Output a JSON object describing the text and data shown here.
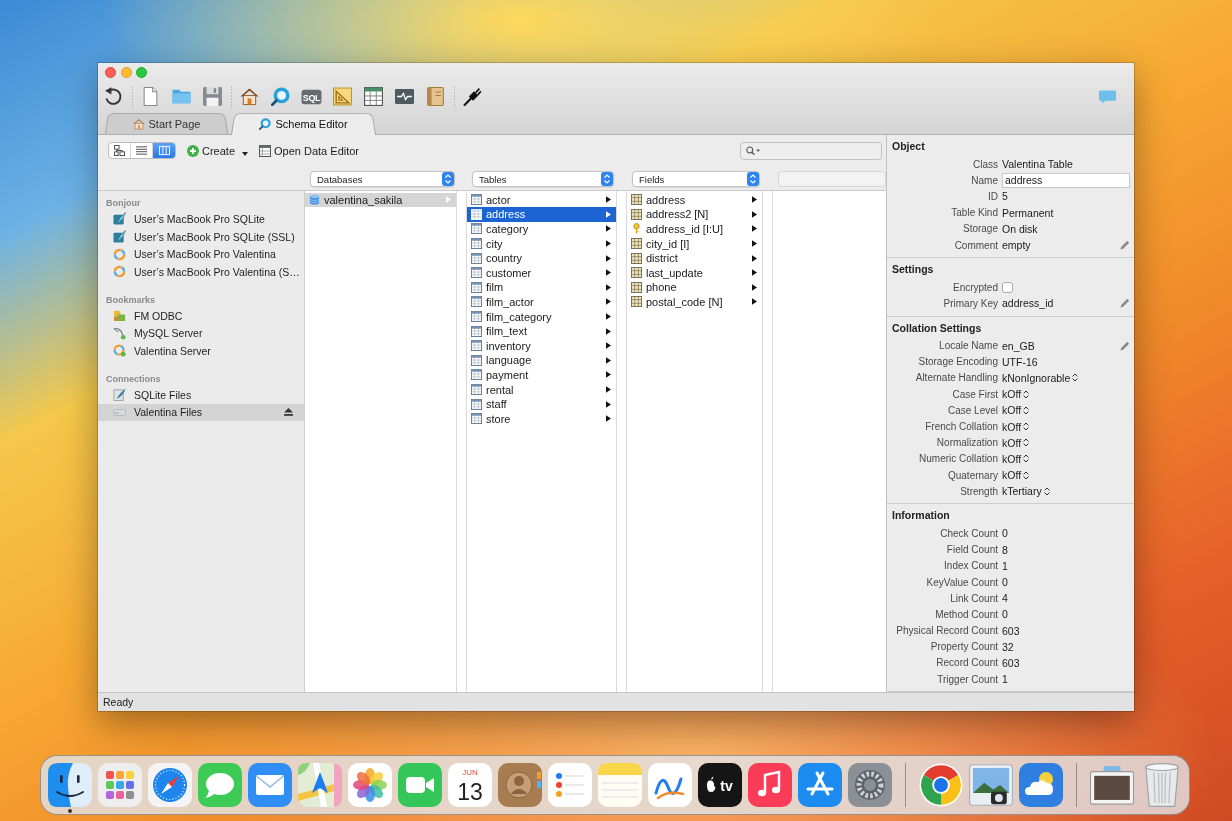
{
  "toolbar": {
    "groups": [
      {
        "items": [
          {
            "kind": "refresh"
          }
        ]
      },
      {
        "items": [
          {
            "kind": "new"
          },
          {
            "kind": "open"
          },
          {
            "kind": "save"
          }
        ]
      },
      {
        "items": [
          {
            "kind": "home"
          },
          {
            "kind": "schema"
          },
          {
            "kind": "sql",
            "label": "SQL"
          },
          {
            "kind": "triangle"
          },
          {
            "kind": "table"
          },
          {
            "kind": "monitor"
          },
          {
            "kind": "book"
          }
        ]
      },
      {
        "items": [
          {
            "kind": "plug"
          }
        ]
      }
    ]
  },
  "tabs": [
    {
      "label": "Start Page",
      "kind": "start",
      "selected": false
    },
    {
      "label": "Schema Editor",
      "kind": "schema",
      "selected": true
    }
  ],
  "view_modes": [
    {
      "kind": "diagram",
      "selected": false
    },
    {
      "kind": "list",
      "selected": false
    },
    {
      "kind": "columns",
      "selected": true
    }
  ],
  "actions": [
    {
      "label": "Create",
      "kind": "create",
      "menu": true
    },
    {
      "label": "Open Data Editor",
      "kind": "data_editor",
      "menu": false
    }
  ],
  "sidebar": {
    "sections": [
      {
        "title": "Bonjour",
        "items": [
          {
            "label": "User’s MacBook Pro SQLite",
            "kind": "sqlite",
            "selected": false,
            "eject": false
          },
          {
            "label": "User’s MacBook Pro SQLite (SSL)",
            "kind": "sqlite",
            "selected": false,
            "eject": false
          },
          {
            "label": "User’s MacBook Pro Valentina",
            "kind": "valentina",
            "selected": false,
            "eject": false
          },
          {
            "label": "User’s MacBook Pro Valentina (S…",
            "kind": "valentina",
            "selected": false,
            "eject": false
          }
        ]
      },
      {
        "title": "Bookmarks",
        "items": [
          {
            "label": "FM ODBC",
            "kind": "odbc",
            "selected": false,
            "eject": false
          },
          {
            "label": "MySQL Server",
            "kind": "mysql",
            "selected": false,
            "eject": false
          },
          {
            "label": "Valentina Server",
            "kind": "valentina_server",
            "selected": false,
            "eject": false
          }
        ]
      },
      {
        "title": "Connections",
        "items": [
          {
            "label": "SQLite Files",
            "kind": "sqlite_files",
            "selected": false,
            "eject": false
          },
          {
            "label": "Valentina Files",
            "kind": "valentina_files",
            "selected": true,
            "eject": true
          }
        ]
      }
    ]
  },
  "browser": {
    "columns": [
      {
        "header": "Databases",
        "active": false,
        "items": [
          {
            "label": "valentina_sakila",
            "kind": "database",
            "selected": true
          }
        ]
      },
      {
        "header": "Tables",
        "active": true,
        "items": [
          {
            "label": "actor",
            "kind": "table",
            "selected": false
          },
          {
            "label": "address",
            "kind": "table",
            "selected": true
          },
          {
            "label": "category",
            "kind": "table",
            "selected": false
          },
          {
            "label": "city",
            "kind": "table",
            "selected": false
          },
          {
            "label": "country",
            "kind": "table",
            "selected": false
          },
          {
            "label": "customer",
            "kind": "table",
            "selected": false
          },
          {
            "label": "film",
            "kind": "table",
            "selected": false
          },
          {
            "label": "film_actor",
            "kind": "table",
            "selected": false
          },
          {
            "label": "film_category",
            "kind": "table",
            "selected": false
          },
          {
            "label": "film_text",
            "kind": "table",
            "selected": false
          },
          {
            "label": "inventory",
            "kind": "table",
            "selected": false
          },
          {
            "label": "language",
            "kind": "table",
            "selected": false
          },
          {
            "label": "payment",
            "kind": "table",
            "selected": false
          },
          {
            "label": "rental",
            "kind": "table",
            "selected": false
          },
          {
            "label": "staff",
            "kind": "table",
            "selected": false
          },
          {
            "label": "store",
            "kind": "table",
            "selected": false
          }
        ]
      },
      {
        "header": "Fields",
        "items": [
          {
            "label": "address",
            "kind": "field",
            "selected": false
          },
          {
            "label": "address2 [N]",
            "kind": "field",
            "selected": false
          },
          {
            "label": "address_id [I:U]",
            "kind": "key",
            "selected": false
          },
          {
            "label": "city_id [I]",
            "kind": "field",
            "selected": false
          },
          {
            "label": "district",
            "kind": "field",
            "selected": false
          },
          {
            "label": "last_update",
            "kind": "field",
            "selected": false
          },
          {
            "label": "phone",
            "kind": "field",
            "selected": false
          },
          {
            "label": "postal_code [N]",
            "kind": "field",
            "selected": false
          }
        ]
      }
    ]
  },
  "inspector": {
    "sections": [
      {
        "title": "Object",
        "rows": [
          {
            "label": "Class",
            "kind": "text",
            "value": "Valentina Table",
            "editable": false
          },
          {
            "label": "Name",
            "kind": "field",
            "value": "address",
            "editable": false
          },
          {
            "label": "ID",
            "kind": "text",
            "value": "5",
            "editable": false
          },
          {
            "label": "Table Kind",
            "kind": "text",
            "value": "Permanent",
            "editable": false
          },
          {
            "label": "Storage",
            "kind": "text",
            "value": "On disk",
            "editable": false
          },
          {
            "label": "Comment",
            "kind": "text",
            "value": "empty",
            "editable": true
          }
        ]
      },
      {
        "title": "Settings",
        "rows": [
          {
            "label": "Encrypted",
            "kind": "checkbox",
            "checked": false,
            "editable": false
          },
          {
            "label": "Primary Key",
            "kind": "text",
            "value": "address_id",
            "editable": true
          }
        ]
      },
      {
        "title": "Collation Settings",
        "rows": [
          {
            "label": "Locale Name",
            "kind": "text",
            "value": "en_GB",
            "editable": true
          },
          {
            "label": "Storage Encoding",
            "kind": "text",
            "value": "UTF-16",
            "editable": false
          },
          {
            "label": "Alternate Handling",
            "kind": "popup",
            "value": "kNonIgnorable",
            "editable": false
          },
          {
            "label": "Case First",
            "kind": "popup",
            "value": "kOff",
            "editable": false
          },
          {
            "label": "Case Level",
            "kind": "popup",
            "value": "kOff",
            "editable": false
          },
          {
            "label": "French Collation",
            "kind": "popup",
            "value": "kOff",
            "editable": false
          },
          {
            "label": "Normalization",
            "kind": "popup",
            "value": "kOff",
            "editable": false
          },
          {
            "label": "Numeric Collation",
            "kind": "popup",
            "value": "kOff",
            "editable": false
          },
          {
            "label": "Quaternary",
            "kind": "popup",
            "value": "kOff",
            "editable": false
          },
          {
            "label": "Strength",
            "kind": "popup",
            "value": "kTertiary",
            "editable": false
          }
        ]
      },
      {
        "title": "Information",
        "rows": [
          {
            "label": "Check Count",
            "kind": "text",
            "value": "0",
            "editable": false
          },
          {
            "label": "Field Count",
            "kind": "text",
            "value": "8",
            "editable": false
          },
          {
            "label": "Index Count",
            "kind": "text",
            "value": "1",
            "editable": false
          },
          {
            "label": "KeyValue Count",
            "kind": "text",
            "value": "0",
            "editable": false
          },
          {
            "label": "Link Count",
            "kind": "text",
            "value": "4",
            "editable": false
          },
          {
            "label": "Method Count",
            "kind": "text",
            "value": "0",
            "editable": false
          },
          {
            "label": "Physical Record Count",
            "kind": "text",
            "value": "603",
            "editable": false
          },
          {
            "label": "Property Count",
            "kind": "text",
            "value": "32",
            "editable": false
          },
          {
            "label": "Record Count",
            "kind": "text",
            "value": "603",
            "editable": false
          },
          {
            "label": "Trigger Count",
            "kind": "text",
            "value": "1",
            "editable": false
          }
        ]
      }
    ]
  },
  "status_bar": {
    "text": "Ready"
  },
  "dock": {
    "groups": [
      {
        "apps": [
          {
            "kind": "finder",
            "running": true
          },
          {
            "kind": "launchpad",
            "running": false
          },
          {
            "kind": "safari",
            "running": false
          },
          {
            "kind": "messages",
            "running": false
          },
          {
            "kind": "mail",
            "running": false
          },
          {
            "kind": "maps",
            "running": false
          },
          {
            "kind": "photos",
            "running": false
          },
          {
            "kind": "facetime",
            "running": false
          },
          {
            "kind": "calendar",
            "month": "JUN",
            "day": "13",
            "running": false
          },
          {
            "kind": "contacts",
            "running": false
          },
          {
            "kind": "reminders",
            "running": false
          },
          {
            "kind": "notes",
            "running": false
          },
          {
            "kind": "freeform",
            "running": false
          },
          {
            "kind": "tv",
            "label": "tv",
            "running": false
          },
          {
            "kind": "music",
            "running": false
          },
          {
            "kind": "appstore",
            "running": false
          },
          {
            "kind": "settings",
            "running": false
          }
        ]
      },
      {
        "apps": [
          {
            "kind": "chrome",
            "running": false
          },
          {
            "kind": "preview",
            "running": false
          },
          {
            "kind": "weather",
            "running": false
          }
        ]
      },
      {
        "apps": [
          {
            "kind": "thumbnail",
            "running": false
          },
          {
            "kind": "trash",
            "running": false
          }
        ]
      }
    ]
  }
}
